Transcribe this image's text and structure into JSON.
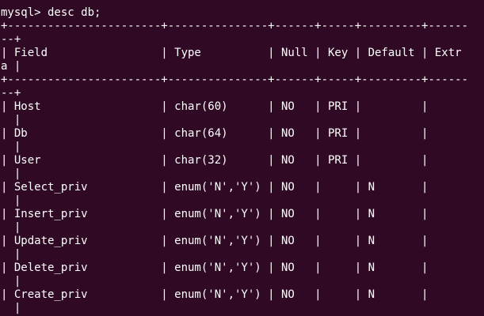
{
  "terminal": {
    "background_color": "#300a24",
    "text_color": "#ffffff",
    "lines": [
      "mysql> desc db;",
      "+-----------------------+---------------+------+-----+---------+------",
      "--+",
      "| Field                 | Type          | Null | Key | Default | Extr",
      "a |",
      "+-----------------------+---------------+------+-----+---------+------",
      "--+",
      "| Host                  | char(60)      | NO   | PRI |         |",
      "  |",
      "| Db                    | char(64)      | NO   | PRI |         |",
      "  |",
      "| User                  | char(32)      | NO   | PRI |         |",
      "  |",
      "| Select_priv           | enum('N','Y') | NO   |     | N       |",
      "  |",
      "| Insert_priv           | enum('N','Y') | NO   |     | N       |",
      "  |",
      "| Update_priv           | enum('N','Y') | NO   |     | N       |",
      "  |",
      "| Delete_priv           | enum('N','Y') | NO   |     | N       |",
      "  |",
      "| Create_priv           | enum('N','Y') | NO   |     | N       |",
      "  |"
    ]
  }
}
